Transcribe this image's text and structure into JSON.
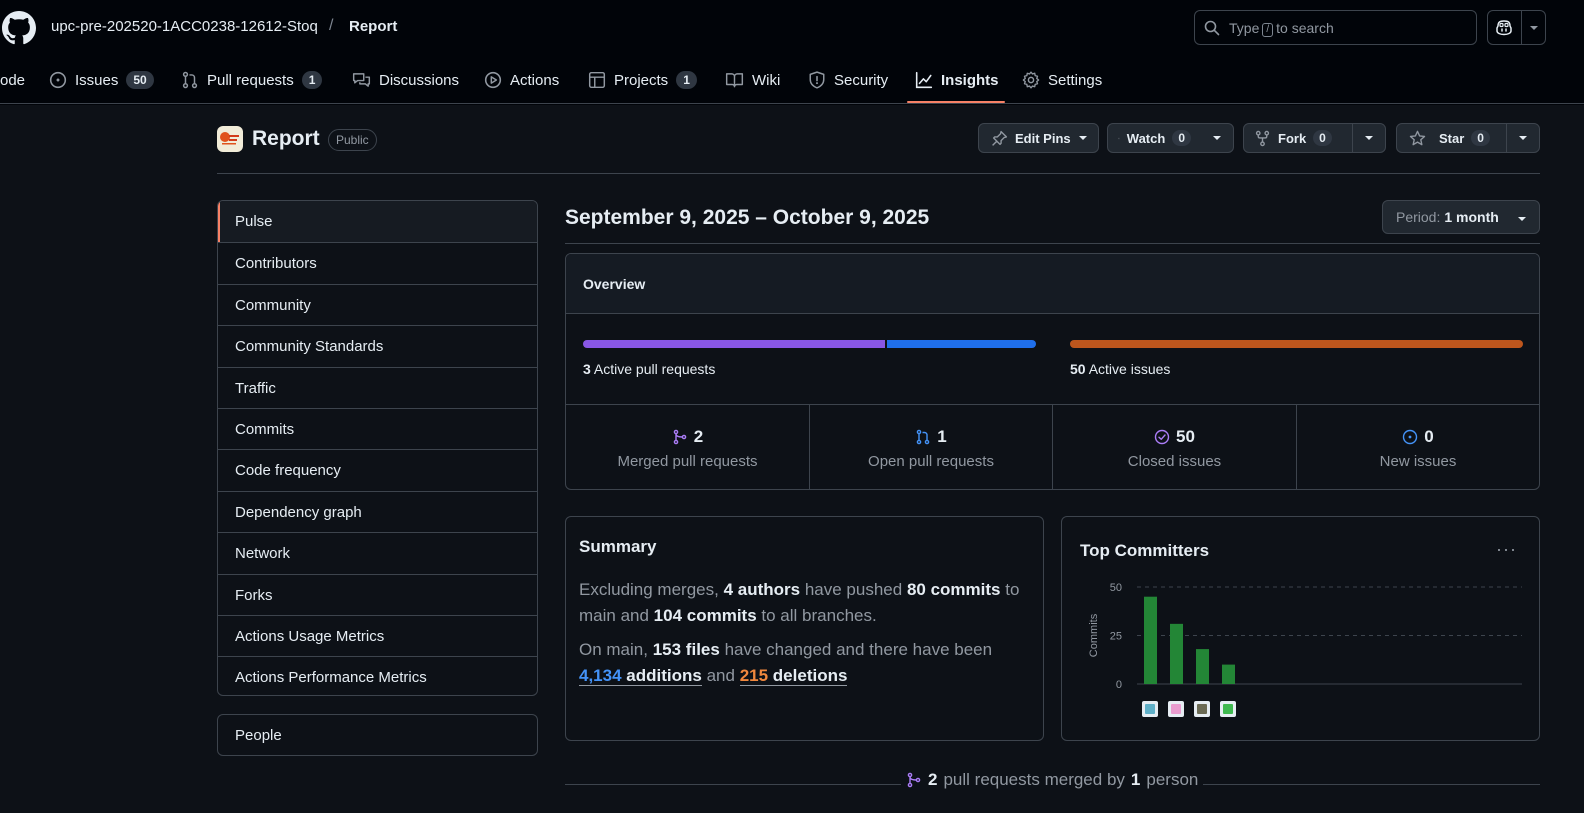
{
  "header": {
    "owner": "upc-pre-202520-1ACC0238-12612-Stoq",
    "separator": "/",
    "repo": "Report",
    "search": {
      "prefix": "Type",
      "key": "/",
      "suffix": "to search"
    }
  },
  "nav": {
    "code": "ode",
    "issues": {
      "label": "Issues",
      "count": "50"
    },
    "pulls": {
      "label": "Pull requests",
      "count": "1"
    },
    "discussions": "Discussions",
    "actions": "Actions",
    "projects": {
      "label": "Projects",
      "count": "1"
    },
    "wiki": "Wiki",
    "security": "Security",
    "insights": "Insights",
    "settings": "Settings"
  },
  "repo": {
    "title": "Report",
    "visibility": "Public",
    "edit_pins": "Edit Pins",
    "watch": {
      "label": "Watch",
      "count": "0"
    },
    "fork": {
      "label": "Fork",
      "count": "0"
    },
    "star": {
      "label": "Star",
      "count": "0"
    }
  },
  "sidebar": {
    "items": [
      "Pulse",
      "Contributors",
      "Community",
      "Community Standards",
      "Traffic",
      "Commits",
      "Code frequency",
      "Dependency graph",
      "Network",
      "Forks",
      "Actions Usage Metrics",
      "Actions Performance Metrics"
    ],
    "active_index": 0,
    "people": "People"
  },
  "period": {
    "title": "September 9, 2025 – October 9, 2025",
    "label": "Period:",
    "value": "1 month"
  },
  "overview": {
    "title": "Overview",
    "active_prs": {
      "count": "3",
      "label": "Active pull requests",
      "merged_fraction": 0.667
    },
    "active_issues": {
      "count": "50",
      "label": "Active issues",
      "closed_fraction": 1.0
    },
    "stats": [
      {
        "value": "2",
        "label": "Merged pull requests",
        "icon": "git-merge-icon",
        "color": "#ab7df8"
      },
      {
        "value": "1",
        "label": "Open pull requests",
        "icon": "git-pull-request-icon",
        "color": "#4493f8"
      },
      {
        "value": "50",
        "label": "Closed issues",
        "icon": "issue-closed-icon",
        "color": "#ab7df8"
      },
      {
        "value": "0",
        "label": "New issues",
        "icon": "issue-opened-icon",
        "color": "#4493f8"
      }
    ]
  },
  "summary": {
    "title": "Summary",
    "p1": {
      "t1": "Excluding merges,",
      "authors": "4 authors",
      "t2": "have pushed",
      "commits_main": "80 commits",
      "t3": "to main and",
      "commits_all": "104 commits",
      "t4": "to all branches."
    },
    "p2": {
      "t1": "On main,",
      "files": "153 files",
      "t2": "have changed and there have been",
      "additions_n": "4,134",
      "additions": "additions",
      "t3": "and",
      "deletions_n": "215",
      "deletions": "deletions"
    }
  },
  "committers": {
    "title": "Top Committers",
    "menu": "···"
  },
  "chart_data": {
    "type": "bar",
    "title": "Top Committers",
    "ylabel": "Commits",
    "ylim": [
      0,
      50
    ],
    "yticks": [
      "0",
      "25",
      "50"
    ],
    "values": [
      45,
      31,
      18,
      10
    ],
    "grid": true,
    "bar_color": "#238636"
  },
  "merged_footer": {
    "count": "2",
    "t1": "pull requests merged by",
    "people": "1",
    "t2": "person"
  },
  "colors": {
    "accent": "#f78166",
    "pr_merged": "#8957e5",
    "pr_open": "#1f6feb",
    "issues_closed": "#bd561d"
  }
}
